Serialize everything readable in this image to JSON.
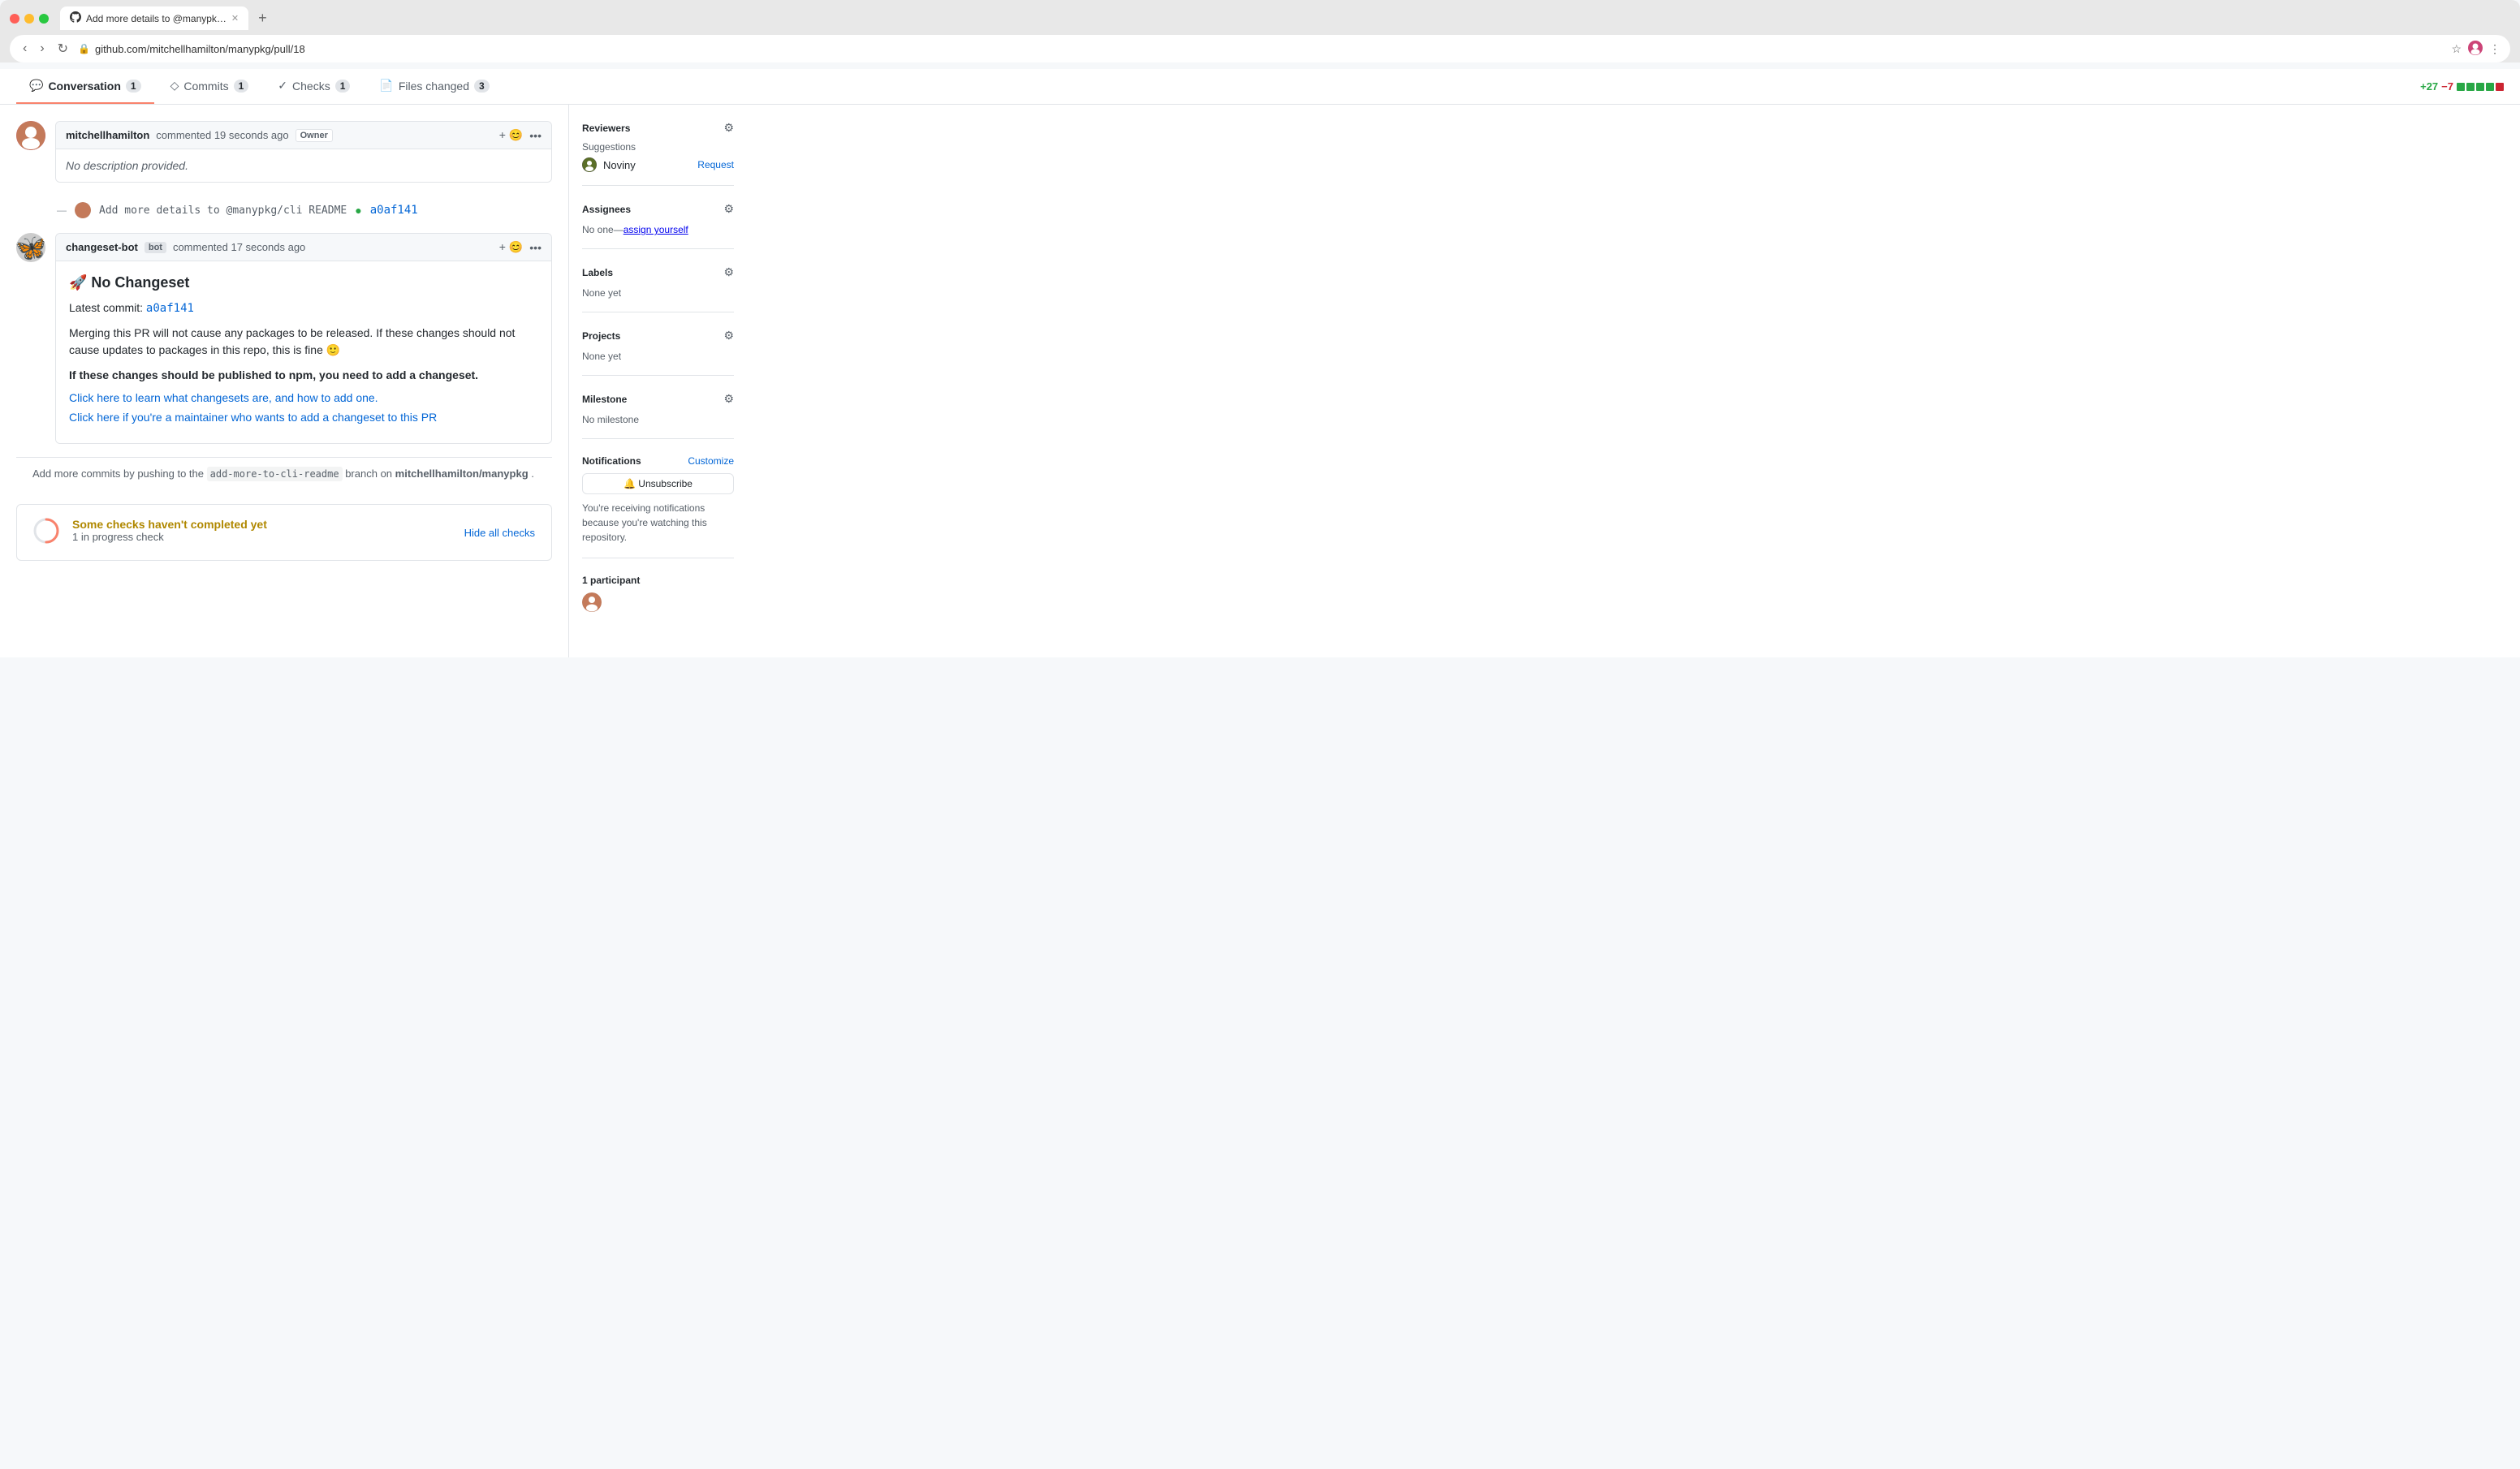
{
  "browser": {
    "url": "github.com/mitchellhamilton/manypkg/pull/18",
    "tab_title": "Add more details to @manypk…",
    "tab_icon": "github"
  },
  "pr_tabs": [
    {
      "label": "Conversation",
      "count": "1",
      "active": true,
      "icon": "💬"
    },
    {
      "label": "Commits",
      "count": "1",
      "active": false,
      "icon": "◇"
    },
    {
      "label": "Checks",
      "count": "1",
      "active": false,
      "icon": "✓"
    },
    {
      "label": "Files changed",
      "count": "3",
      "active": false,
      "icon": "📄"
    }
  ],
  "diff_stats": {
    "additions": "+27",
    "deletions": "−7",
    "bars": [
      "green",
      "green",
      "green",
      "green",
      "red"
    ]
  },
  "comments": [
    {
      "author": "mitchellhamilton",
      "time_ago": "commented 19 seconds ago",
      "badge": "Owner",
      "body": "No description provided."
    },
    {
      "author": "changeset-bot",
      "is_bot": true,
      "time_ago": "commented 17 seconds ago",
      "title": "🚀 No Changeset",
      "latest_commit_label": "Latest commit:",
      "latest_commit_hash": "a0af141",
      "merging_text": "Merging this PR will not cause any packages to be released. If these changes should not cause updates to packages in this repo, this is fine 🙂",
      "bold_note": "If these changes should be published to npm, you need to add a changeset.",
      "link1": "Click here to learn what changesets are, and how to add one.",
      "link2": "Click here if you're a maintainer who wants to add a changeset to this PR"
    }
  ],
  "commit_ref": {
    "message": "Add more details to @manypkg/cli README",
    "hash": "a0af141",
    "avatar_present": true
  },
  "push_suggestion": {
    "prefix": "Add more commits by pushing to the",
    "branch": "add-more-to-cli-readme",
    "suffix": "branch on",
    "repo": "mitchellhamilton/manypkg",
    "end": "."
  },
  "checks": {
    "title": "Some checks haven't completed yet",
    "subtitle": "1 in progress check",
    "hide_label": "Hide all checks"
  },
  "sidebar": {
    "reviewers": {
      "title": "Reviewers",
      "suggestion_label": "Suggestions",
      "reviewer_name": "Noviny",
      "request_label": "Request"
    },
    "assignees": {
      "title": "Assignees",
      "value": "No one—assign yourself"
    },
    "labels": {
      "title": "Labels",
      "value": "None yet"
    },
    "projects": {
      "title": "Projects",
      "value": "None yet"
    },
    "milestone": {
      "title": "Milestone",
      "value": "No milestone"
    },
    "notifications": {
      "title": "Notifications",
      "customize_label": "Customize",
      "unsubscribe_label": "🔔 Unsubscribe",
      "description": "You're receiving notifications because you're watching this repository."
    },
    "participants": {
      "title": "1 participant"
    }
  }
}
